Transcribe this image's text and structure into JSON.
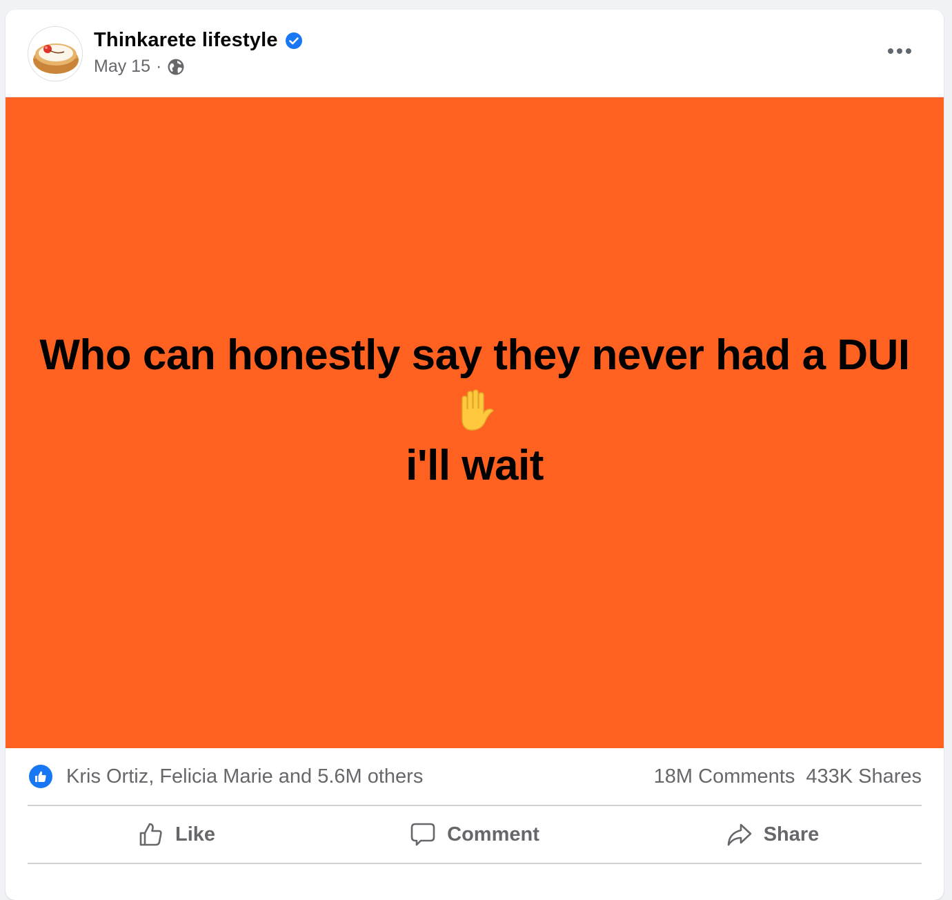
{
  "post": {
    "author": "Thinkarete lifestyle",
    "date": "May 15",
    "separator": "·",
    "privacy_icon": "globe-icon",
    "verified_icon": "verified-badge-icon",
    "more_icon": "more-options-icon",
    "background_color": "#ff6121",
    "text_line_1": "Who can honestly say they never had a DUI",
    "emoji": "✋",
    "text_line_2": "i'll wait"
  },
  "stats": {
    "reaction_icon": "like-reaction-icon",
    "reactions_text": "Kris Ortiz, Felicia Marie and 5.6M others",
    "comments": "18M Comments",
    "shares": "433K Shares"
  },
  "actions": {
    "like": {
      "label": "Like",
      "icon": "thumbs-up-icon"
    },
    "comment": {
      "label": "Comment",
      "icon": "comment-bubble-icon"
    },
    "share": {
      "label": "Share",
      "icon": "share-arrow-icon"
    }
  },
  "colors": {
    "accent_blue": "#1877f2",
    "secondary_text": "#65676b"
  }
}
